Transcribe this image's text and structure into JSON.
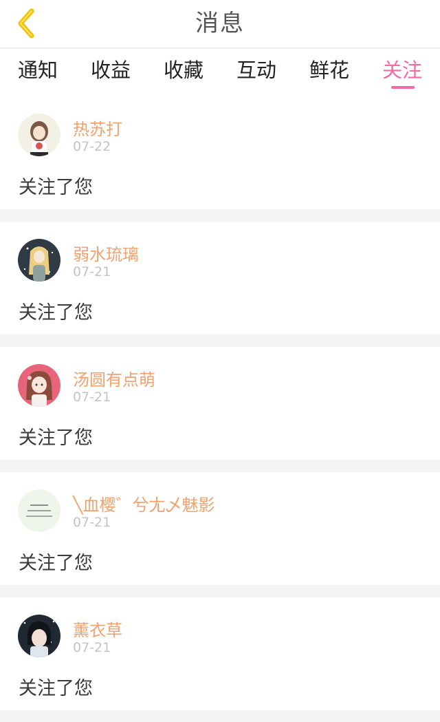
{
  "header": {
    "title": "消息",
    "back_icon": "chevron-left-icon",
    "back_color": "#f2c200"
  },
  "tabs": [
    {
      "label": "通知"
    },
    {
      "label": "收益"
    },
    {
      "label": "收藏"
    },
    {
      "label": "互动"
    },
    {
      "label": "鲜花"
    },
    {
      "label": "关注"
    }
  ],
  "active_tab": "关注",
  "colors": {
    "accent": "#f06aa5",
    "username": "#f0a26e",
    "date": "#c4c4c4"
  },
  "notifications": [
    {
      "username": "热苏打",
      "date": "07-22",
      "message": "关注了您"
    },
    {
      "username": "弱水琉璃",
      "date": "07-21",
      "message": "关注了您"
    },
    {
      "username": "汤圆有点萌",
      "date": "07-21",
      "message": "关注了您"
    },
    {
      "username": "╲血樱゛兮尢乄魅影",
      "date": "07-21",
      "message": "关注了您"
    },
    {
      "username": "薰衣草",
      "date": "07-21",
      "message": "关注了您"
    }
  ]
}
